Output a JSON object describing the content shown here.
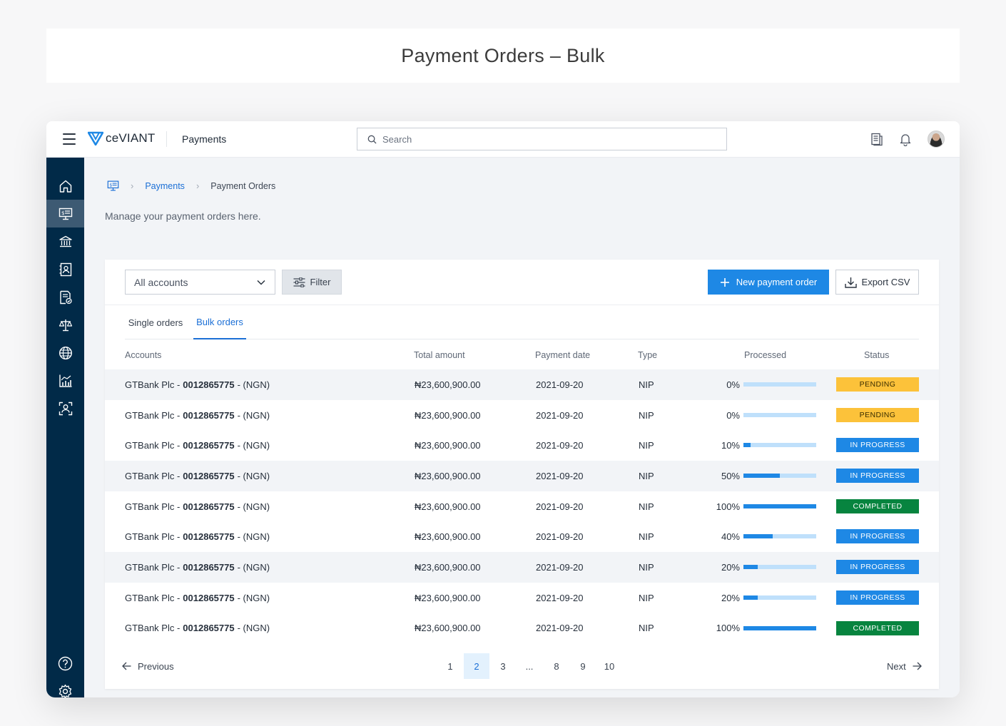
{
  "page": {
    "heading": "Payment Orders – Bulk"
  },
  "topbar": {
    "brand": "ceVIANT",
    "app_name": "Payments",
    "search_placeholder": "Search"
  },
  "breadcrumb": {
    "items": [
      "Payments",
      "Payment Orders"
    ]
  },
  "subtitle": "Manage your payment orders here.",
  "toolbar": {
    "account_select": "All accounts",
    "filter_label": "Filter",
    "new_label": "New payment order",
    "export_label": "Export CSV"
  },
  "tabs": {
    "single": "Single orders",
    "bulk": "Bulk orders",
    "active": "bulk"
  },
  "table": {
    "columns": [
      "Accounts",
      "Total amount",
      "Payment date",
      "Type",
      "Processed",
      "Status"
    ],
    "rows": [
      {
        "bank": "GTBank Plc -",
        "account_no": "0012865775",
        "currency": "- (NGN)",
        "amount": "₦23,600,900.00",
        "date": "2021-09-20",
        "type": "NIP",
        "processed": "0%",
        "processed_fraction": 0,
        "status": "PENDING"
      },
      {
        "bank": "GTBank Plc -",
        "account_no": "0012865775",
        "currency": "- (NGN)",
        "amount": "₦23,600,900.00",
        "date": "2021-09-20",
        "type": "NIP",
        "processed": "0%",
        "processed_fraction": 0,
        "status": "PENDING"
      },
      {
        "bank": "GTBank Plc -",
        "account_no": "0012865775",
        "currency": "- (NGN)",
        "amount": "₦23,600,900.00",
        "date": "2021-09-20",
        "type": "NIP",
        "processed": "10%",
        "processed_fraction": 0.1,
        "status": "IN PROGRESS"
      },
      {
        "bank": "GTBank Plc -",
        "account_no": "0012865775",
        "currency": "- (NGN)",
        "amount": "₦23,600,900.00",
        "date": "2021-09-20",
        "type": "NIP",
        "processed": "50%",
        "processed_fraction": 0.5,
        "status": "IN PROGRESS"
      },
      {
        "bank": "GTBank Plc -",
        "account_no": "0012865775",
        "currency": "- (NGN)",
        "amount": "₦23,600,900.00",
        "date": "2021-09-20",
        "type": "NIP",
        "processed": "100%",
        "processed_fraction": 1,
        "status": "COMPLETED"
      },
      {
        "bank": "GTBank Plc -",
        "account_no": "0012865775",
        "currency": "- (NGN)",
        "amount": "₦23,600,900.00",
        "date": "2021-09-20",
        "type": "NIP",
        "processed": "40%",
        "processed_fraction": 0.4,
        "status": "IN PROGRESS"
      },
      {
        "bank": "GTBank Plc -",
        "account_no": "0012865775",
        "currency": "- (NGN)",
        "amount": "₦23,600,900.00",
        "date": "2021-09-20",
        "type": "NIP",
        "processed": "20%",
        "processed_fraction": 0.2,
        "status": "IN PROGRESS"
      },
      {
        "bank": "GTBank Plc -",
        "account_no": "0012865775",
        "currency": "- (NGN)",
        "amount": "₦23,600,900.00",
        "date": "2021-09-20",
        "type": "NIP",
        "processed": "20%",
        "processed_fraction": 0.2,
        "status": "IN PROGRESS"
      },
      {
        "bank": "GTBank Plc -",
        "account_no": "0012865775",
        "currency": "- (NGN)",
        "amount": "₦23,600,900.00",
        "date": "2021-09-20",
        "type": "NIP",
        "processed": "100%",
        "processed_fraction": 1,
        "status": "COMPLETED"
      }
    ]
  },
  "status_colors": {
    "PENDING": {
      "bg": "#fcc23a",
      "fg": "#3a2e00"
    },
    "IN PROGRESS": {
      "bg": "#1e88e5",
      "fg": "#ffffff"
    },
    "COMPLETED": {
      "bg": "#07843f",
      "fg": "#ffffff"
    }
  },
  "pagination": {
    "previous": "Previous",
    "next": "Next",
    "pages": [
      "1",
      "2",
      "3",
      "...",
      "8",
      "9",
      "10"
    ],
    "current": "2"
  },
  "colors": {
    "accent": "#1e88e5",
    "sidebar": "#012a48",
    "sidebar_active": "#3d5a73"
  },
  "sidebar": {
    "icons": [
      "home-icon",
      "payments-icon",
      "bank-icon",
      "contacts-icon",
      "statements-icon",
      "scale-icon",
      "globe-icon",
      "analytics-icon",
      "user-scan-icon"
    ],
    "bottom_icons": [
      "help-icon",
      "settings-icon"
    ],
    "active_index": 1
  }
}
